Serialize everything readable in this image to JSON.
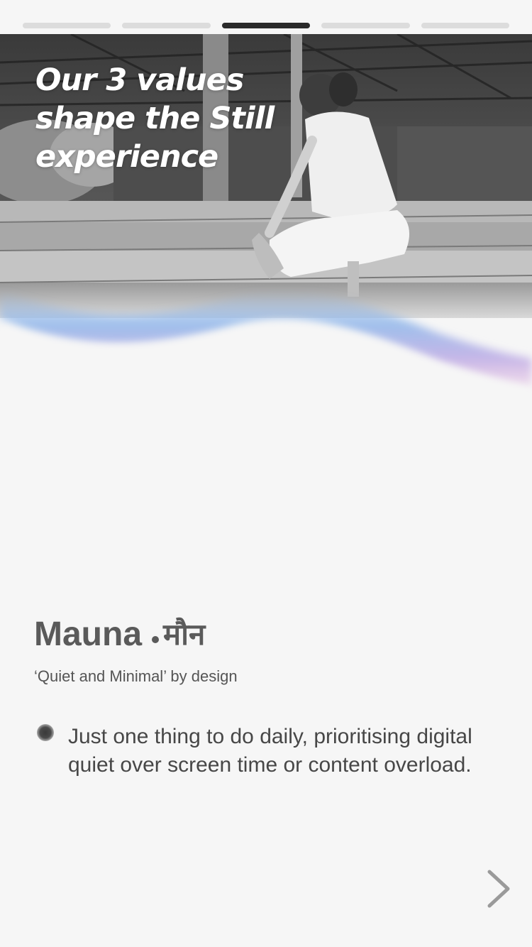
{
  "progress": {
    "total": 5,
    "current": 3
  },
  "hero": {
    "headline_prefix": "Our ",
    "headline_bold": "3 values",
    "headline_rest": "shape the Still experience",
    "image": "photo-woman-sitting-on-steps-grayscale"
  },
  "value": {
    "name": "Mauna",
    "name_hindi": "मौन",
    "tagline": "‘Quiet and Minimal’ by design",
    "description": "Just one thing to do daily, prioritising digital quiet over screen time or content overload."
  },
  "navigation": {
    "next_icon": "chevron-right-icon"
  },
  "colors": {
    "background": "#f6f6f6",
    "progress_active": "#2b2b2b",
    "progress_inactive": "#dcdcdc",
    "text_primary": "#5a5a5a",
    "wave_blue": "#8fb6ea",
    "wave_pink": "#d79ad6"
  }
}
